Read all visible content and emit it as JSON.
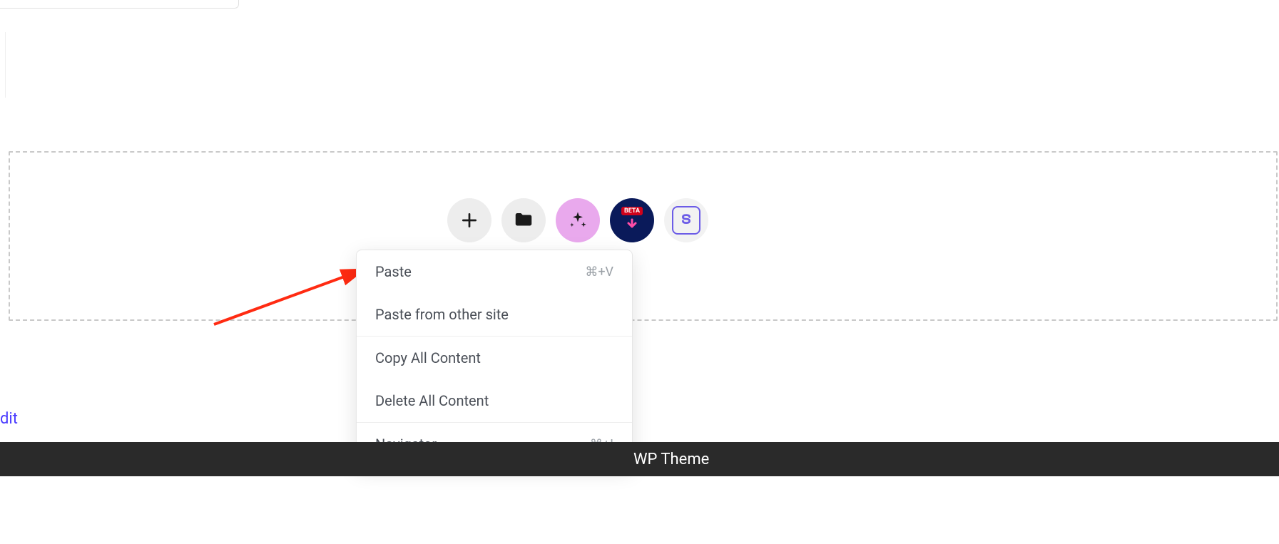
{
  "toolbar": {
    "beta_label": "BETA"
  },
  "context_menu": {
    "items": [
      {
        "label": "Paste",
        "shortcut": "⌘+V"
      },
      {
        "label": "Paste from other site",
        "shortcut": ""
      },
      {
        "label": "Copy All Content",
        "shortcut": ""
      },
      {
        "label": "Delete All Content",
        "shortcut": ""
      },
      {
        "label": "Navigator",
        "shortcut": "⌘+I"
      }
    ]
  },
  "edit_link": {
    "label": "dit"
  },
  "footer": {
    "text": "WP Theme"
  }
}
